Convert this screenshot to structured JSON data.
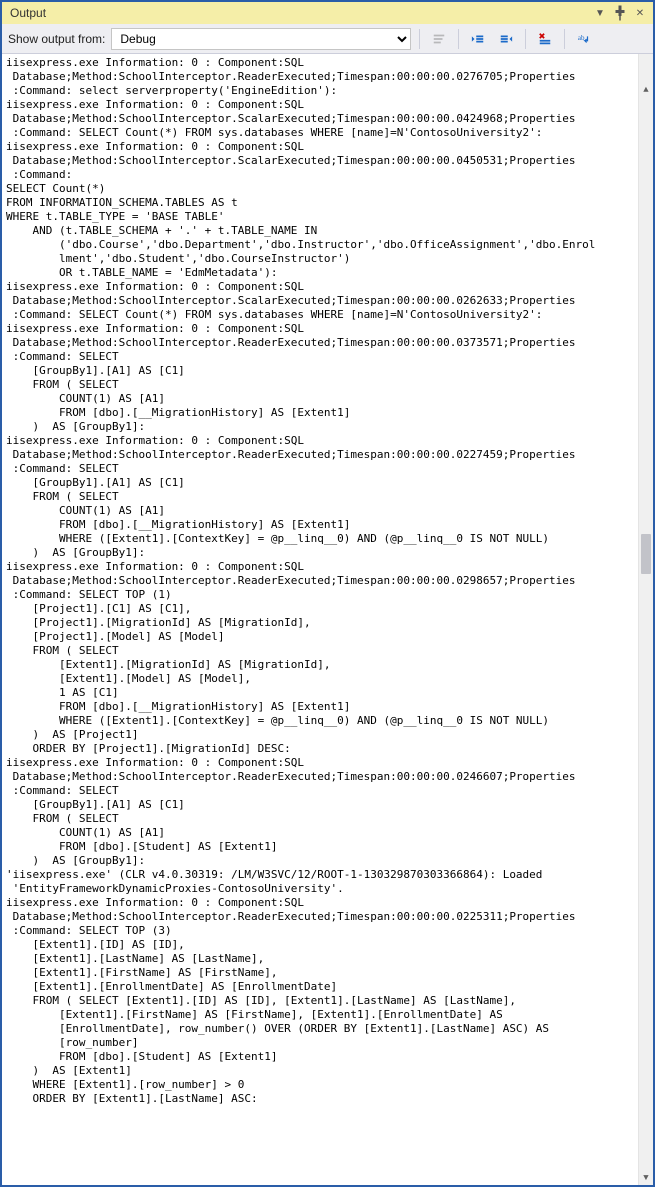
{
  "titlebar": {
    "title": "Output"
  },
  "toolbar": {
    "label_show_output_from": "Show output from:",
    "source_selected": "Debug"
  },
  "output_lines": [
    "iisexpress.exe Information: 0 : Component:SQL ",
    " Database;Method:SchoolInterceptor.ReaderExecuted;Timespan:00:00:00.0276705;Properties",
    " :Command: select serverproperty('EngineEdition'):",
    "iisexpress.exe Information: 0 : Component:SQL ",
    " Database;Method:SchoolInterceptor.ScalarExecuted;Timespan:00:00:00.0424968;Properties",
    " :Command: SELECT Count(*) FROM sys.databases WHERE [name]=N'ContosoUniversity2':",
    "iisexpress.exe Information: 0 : Component:SQL ",
    " Database;Method:SchoolInterceptor.ScalarExecuted;Timespan:00:00:00.0450531;Properties",
    " :Command: ",
    "SELECT Count(*)",
    "FROM INFORMATION_SCHEMA.TABLES AS t",
    "WHERE t.TABLE_TYPE = 'BASE TABLE'",
    "    AND (t.TABLE_SCHEMA + '.' + t.TABLE_NAME IN ",
    "        ('dbo.Course','dbo.Department','dbo.Instructor','dbo.OfficeAssignment','dbo.Enrol",
    "        lment','dbo.Student','dbo.CourseInstructor')",
    "        OR t.TABLE_NAME = 'EdmMetadata'):",
    "iisexpress.exe Information: 0 : Component:SQL ",
    " Database;Method:SchoolInterceptor.ScalarExecuted;Timespan:00:00:00.0262633;Properties",
    " :Command: SELECT Count(*) FROM sys.databases WHERE [name]=N'ContosoUniversity2':",
    "iisexpress.exe Information: 0 : Component:SQL ",
    " Database;Method:SchoolInterceptor.ReaderExecuted;Timespan:00:00:00.0373571;Properties",
    " :Command: SELECT ",
    "    [GroupBy1].[A1] AS [C1]",
    "    FROM ( SELECT ",
    "        COUNT(1) AS [A1]",
    "        FROM [dbo].[__MigrationHistory] AS [Extent1]",
    "    )  AS [GroupBy1]:",
    "iisexpress.exe Information: 0 : Component:SQL ",
    " Database;Method:SchoolInterceptor.ReaderExecuted;Timespan:00:00:00.0227459;Properties",
    " :Command: SELECT ",
    "    [GroupBy1].[A1] AS [C1]",
    "    FROM ( SELECT ",
    "        COUNT(1) AS [A1]",
    "        FROM [dbo].[__MigrationHistory] AS [Extent1]",
    "        WHERE ([Extent1].[ContextKey] = @p__linq__0) AND (@p__linq__0 IS NOT NULL)",
    "    )  AS [GroupBy1]:",
    "iisexpress.exe Information: 0 : Component:SQL ",
    " Database;Method:SchoolInterceptor.ReaderExecuted;Timespan:00:00:00.0298657;Properties",
    " :Command: SELECT TOP (1) ",
    "    [Project1].[C1] AS [C1], ",
    "    [Project1].[MigrationId] AS [MigrationId], ",
    "    [Project1].[Model] AS [Model]",
    "    FROM ( SELECT ",
    "        [Extent1].[MigrationId] AS [MigrationId], ",
    "        [Extent1].[Model] AS [Model], ",
    "        1 AS [C1]",
    "        FROM [dbo].[__MigrationHistory] AS [Extent1]",
    "        WHERE ([Extent1].[ContextKey] = @p__linq__0) AND (@p__linq__0 IS NOT NULL)",
    "    )  AS [Project1]",
    "    ORDER BY [Project1].[MigrationId] DESC:",
    "iisexpress.exe Information: 0 : Component:SQL ",
    " Database;Method:SchoolInterceptor.ReaderExecuted;Timespan:00:00:00.0246607;Properties",
    " :Command: SELECT ",
    "    [GroupBy1].[A1] AS [C1]",
    "    FROM ( SELECT ",
    "        COUNT(1) AS [A1]",
    "        FROM [dbo].[Student] AS [Extent1]",
    "    )  AS [GroupBy1]:",
    "'iisexpress.exe' (CLR v4.0.30319: /LM/W3SVC/12/ROOT-1-130329870303366864): Loaded ",
    " 'EntityFrameworkDynamicProxies-ContosoUniversity'. ",
    "iisexpress.exe Information: 0 : Component:SQL ",
    " Database;Method:SchoolInterceptor.ReaderExecuted;Timespan:00:00:00.0225311;Properties",
    " :Command: SELECT TOP (3) ",
    "    [Extent1].[ID] AS [ID], ",
    "    [Extent1].[LastName] AS [LastName], ",
    "    [Extent1].[FirstName] AS [FirstName], ",
    "    [Extent1].[EnrollmentDate] AS [EnrollmentDate]",
    "    FROM ( SELECT [Extent1].[ID] AS [ID], [Extent1].[LastName] AS [LastName], ",
    "        [Extent1].[FirstName] AS [FirstName], [Extent1].[EnrollmentDate] AS ",
    "        [EnrollmentDate], row_number() OVER (ORDER BY [Extent1].[LastName] ASC) AS ",
    "        [row_number]",
    "        FROM [dbo].[Student] AS [Extent1]",
    "    )  AS [Extent1]",
    "    WHERE [Extent1].[row_number] > 0",
    "    ORDER BY [Extent1].[LastName] ASC:"
  ]
}
